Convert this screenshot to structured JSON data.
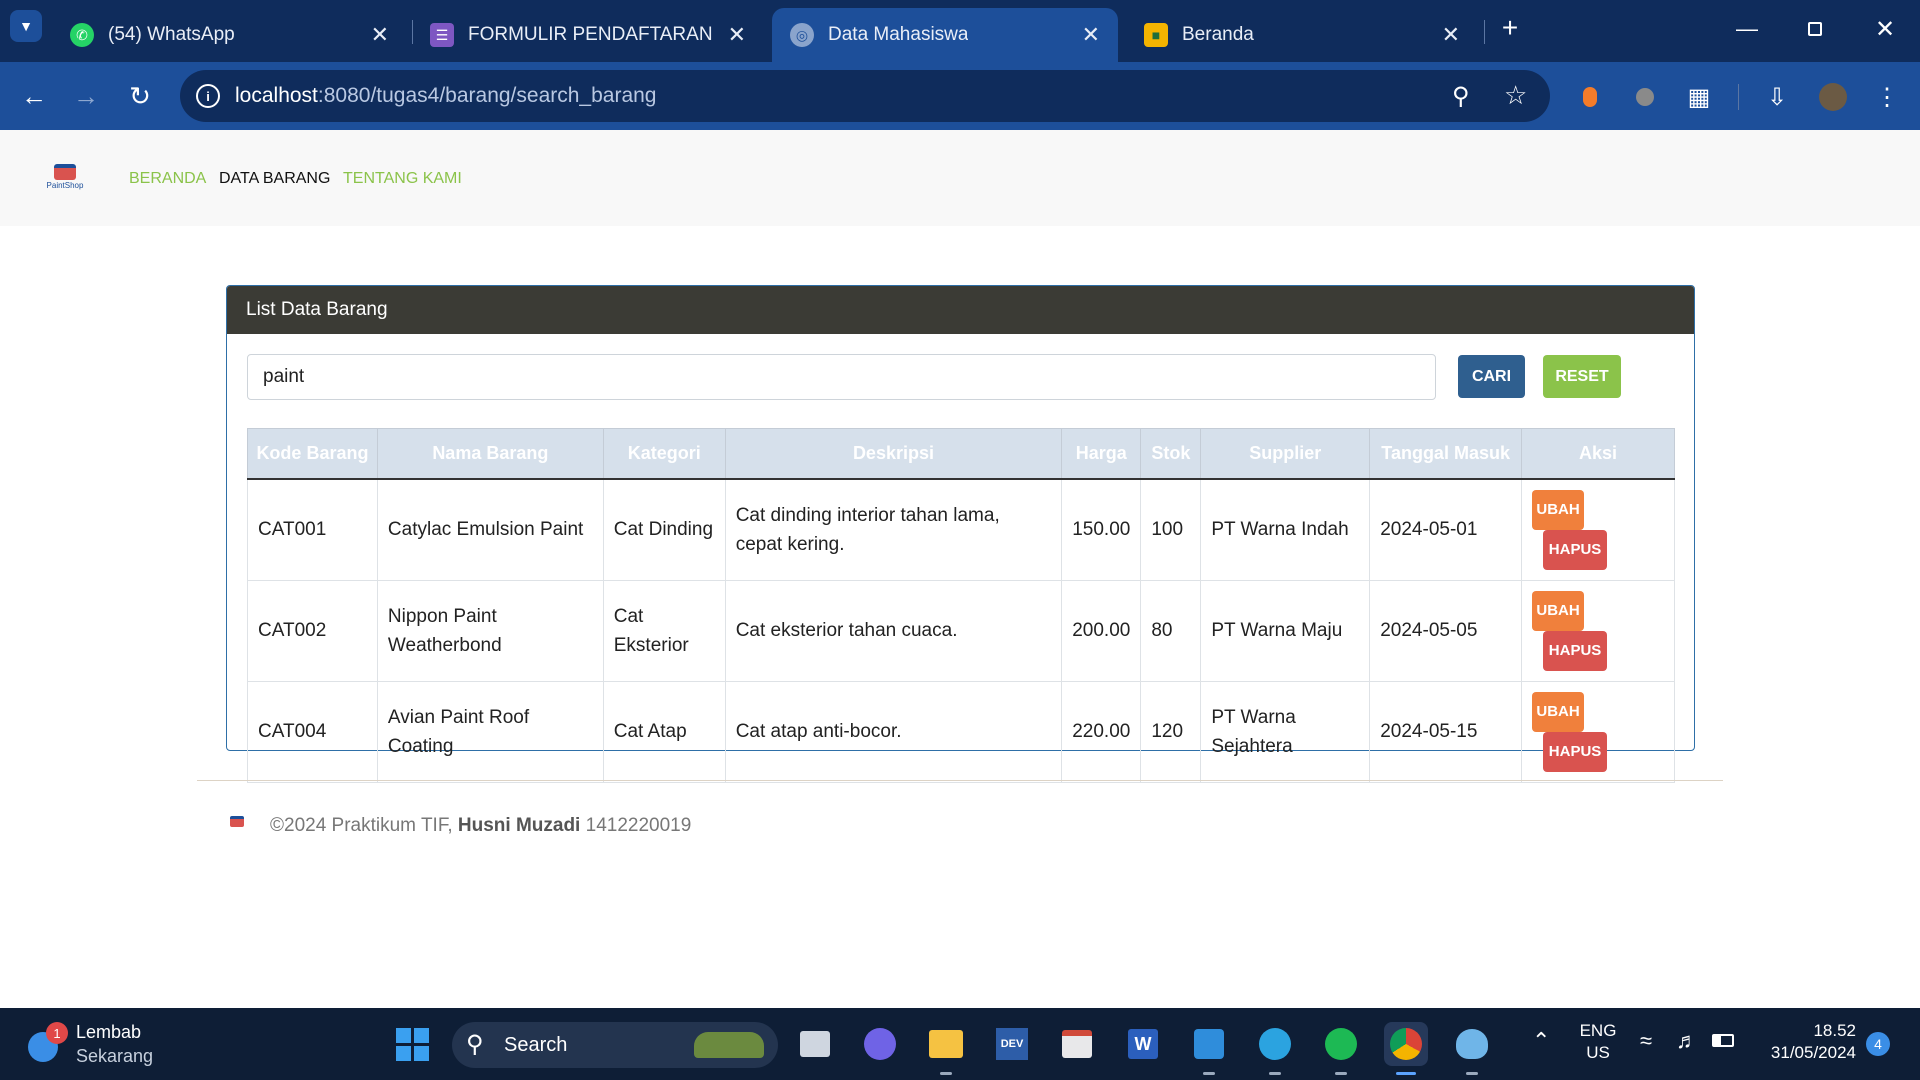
{
  "browser": {
    "tabs": [
      {
        "title": "(54) WhatsApp",
        "icon": "whatsapp-icon"
      },
      {
        "title": "FORMULIR PENDAFTARAN SMP",
        "icon": "forms-icon"
      },
      {
        "title": "Data Mahasiswa",
        "icon": "globe-icon",
        "active": true
      },
      {
        "title": "Beranda",
        "icon": "classroom-icon"
      }
    ],
    "url_host": "localhost",
    "url_path": ":8080/tugas4/barang/search_barang"
  },
  "navbar": {
    "logo_text": "PaintShop",
    "links": [
      "BERANDA",
      "DATA BARANG",
      "TENTANG KAMI"
    ]
  },
  "card": {
    "header": "List Data Barang",
    "search_value": "paint",
    "cari_label": "CARI",
    "reset_label": "RESET",
    "columns": [
      "Kode Barang",
      "Nama Barang",
      "Kategori",
      "Deskripsi",
      "Harga",
      "Stok",
      "Supplier",
      "Tanggal Masuk",
      "Aksi"
    ],
    "rows": [
      {
        "kode": "CAT001",
        "nama": "Catylac Emulsion Paint",
        "kategori": "Cat Dinding",
        "deskripsi": "Cat dinding interior tahan lama, cepat kering.",
        "harga": "150.00",
        "stok": "100",
        "supplier": "PT Warna Indah",
        "tanggal": "2024-05-01"
      },
      {
        "kode": "CAT002",
        "nama": "Nippon Paint Weatherbond",
        "kategori": "Cat Eksterior",
        "deskripsi": "Cat eksterior tahan cuaca.",
        "harga": "200.00",
        "stok": "80",
        "supplier": "PT Warna Maju",
        "tanggal": "2024-05-05"
      },
      {
        "kode": "CAT004",
        "nama": "Avian Paint Roof Coating",
        "kategori": "Cat Atap",
        "deskripsi": "Cat atap anti-bocor.",
        "harga": "220.00",
        "stok": "120",
        "supplier": "PT Warna Sejahtera",
        "tanggal": "2024-05-15"
      }
    ],
    "ubah_label": "UBAH",
    "hapus_label": "HAPUS"
  },
  "footer": {
    "prefix": "©2024 Praktikum TIF,",
    "name": "Husni Muzadi",
    "nim": "1412220019"
  },
  "taskbar": {
    "weather_badge": "1",
    "weather_title": "Lembab",
    "weather_sub": "Sekarang",
    "search_label": "Search",
    "lang_top": "ENG",
    "lang_bottom": "US",
    "time": "18.52",
    "date": "31/05/2024",
    "notif_count": "4"
  },
  "colors": {
    "browser_dark": "#0f2c5c",
    "browser_active": "#1d4f9a",
    "nav_green": "#8bc34a",
    "cari_blue": "#2f5f8f",
    "reset_green": "#8bc34a",
    "ubah_orange": "#f0803c",
    "hapus_red": "#d9534f"
  }
}
